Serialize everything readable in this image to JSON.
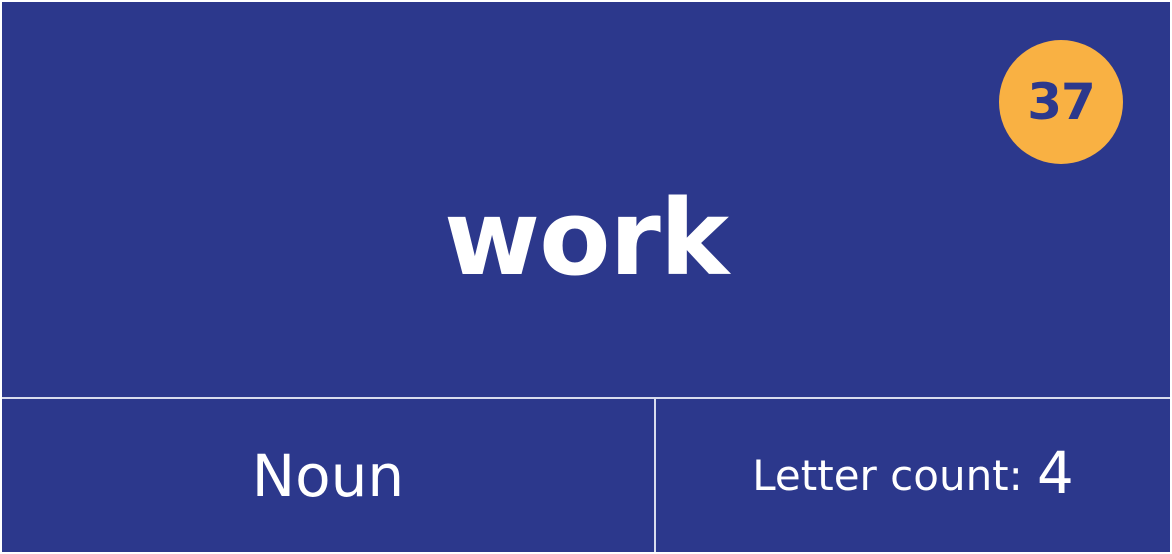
{
  "card": {
    "word": "work",
    "rank": "37",
    "part_of_speech": "Noun",
    "letter_count_label": "Letter count:",
    "letter_count_value": "4"
  },
  "colors": {
    "background": "#2c388c",
    "badge": "#f9b143",
    "text": "#ffffff",
    "divider": "#d9dcee"
  }
}
